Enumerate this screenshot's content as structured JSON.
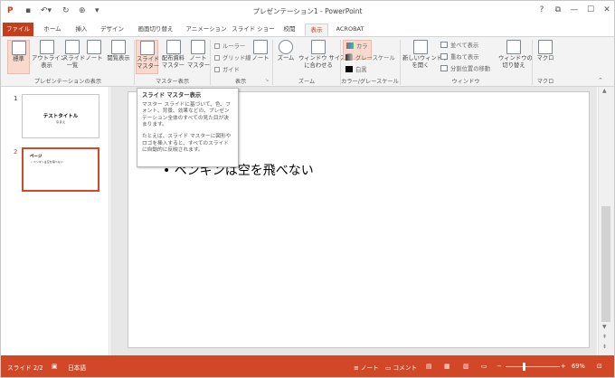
{
  "app": {
    "title": "プレゼンテーション1 - PowerPoint"
  },
  "window_controls": {
    "help": "?",
    "restore_ribbon": "⧉",
    "minimize": "—",
    "maximize": "☐",
    "close": "✕"
  },
  "tabs": [
    "ファイル",
    "ホーム",
    "挿入",
    "デザイン",
    "画面切り替え",
    "アニメーション",
    "スライド ショー",
    "校閲",
    "表示",
    "ACROBAT"
  ],
  "ribbon": {
    "view_group": {
      "label": "プレゼンテーションの表示",
      "buttons": [
        "標準",
        "アウトライン\n表示",
        "スライド\n一覧",
        "ノート",
        "閲覧表示"
      ]
    },
    "master_group": {
      "label": "マスター表示",
      "buttons": [
        "スライド\nマスター",
        "配布資料\nマスター",
        "ノート\nマスター"
      ]
    },
    "show_group": {
      "label": "表示",
      "checks": [
        "ルーラー",
        "グリッド線",
        "ガイド"
      ],
      "notes": "ノート"
    },
    "zoom_group": {
      "label": "ズーム",
      "zoom": "ズーム",
      "fit": "ウィンドウ サイズ\nに合わせる"
    },
    "color_group": {
      "label": "カラー/グレースケール",
      "options": [
        "カラー",
        "グレースケール",
        "白黒"
      ]
    },
    "window_group": {
      "label": "ウィンドウ",
      "new_window": "新しいウィンドウ\nを開く",
      "items": [
        "並べて表示",
        "重ねて表示",
        "分割位置の移動"
      ],
      "switch": "ウィンドウの\n切り替え"
    },
    "macro_group": {
      "label": "マクロ",
      "macro": "マクロ"
    }
  },
  "tooltip": {
    "title": "スライド マスター表示",
    "body1": "マスター スライドに基づいて、色、フォント、背景、効果などの、プレゼンテーション全体のすべての見た目が決まります。",
    "body2": "たとえば、スライド マスターに図形やロゴを挿入すると、すべてのスライドに自動的に反映されます。"
  },
  "slides": [
    {
      "num": "1",
      "title": "テストタイトル",
      "sub": "なまえ"
    },
    {
      "num": "2",
      "title": "ページ",
      "bullet": "• ペンギンは空を飛べない"
    }
  ],
  "slide_content": {
    "bullet": "• ペンギンは空を飛べない"
  },
  "status": {
    "slide": "スライド 2/2",
    "language": "日本語",
    "notes": "ノート",
    "comments": "コメント",
    "zoom": "69%"
  },
  "colors": {
    "accent": "#d24726",
    "file_tab": "#c43e1c"
  }
}
